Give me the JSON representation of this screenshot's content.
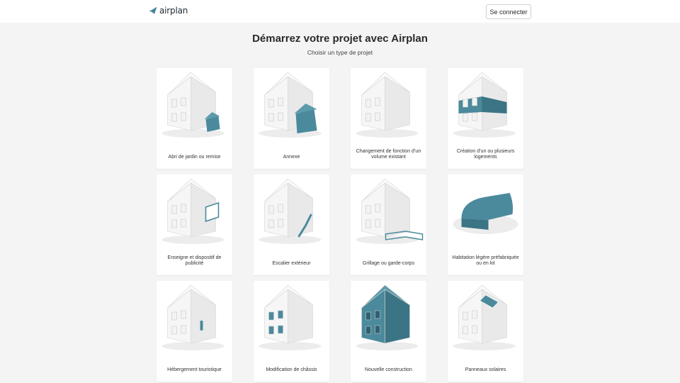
{
  "header": {
    "logo_text": "airplan",
    "logo_icon": "paper-plane-icon",
    "login_label": "Se connecter"
  },
  "main": {
    "title": "Démarrez votre projet avec Airplan",
    "subtitle": "Choisir un type de projet"
  },
  "colors": {
    "accent": "#4a8a9c",
    "house": "#f6f6f6",
    "page_bg": "#f4f4f4"
  },
  "projects": [
    {
      "label": "Abri de jardin ou remise",
      "art": "house-with-shed"
    },
    {
      "label": "Annexe",
      "art": "house-with-annex"
    },
    {
      "label": "Changement de fonction d’un volume existant",
      "art": "house-plain"
    },
    {
      "label": "Création d’un ou plusieurs logements",
      "art": "house-highlighted-floor"
    },
    {
      "label": "Enseigne et dispositif de publicité",
      "art": "house-with-sign"
    },
    {
      "label": "Escalier extérieur",
      "art": "house-with-stairs"
    },
    {
      "label": "Grillage ou garde-corps",
      "art": "house-with-fence"
    },
    {
      "label": "Habitation légère préfabriquée ou en kit",
      "art": "tiny-house"
    },
    {
      "label": "Hébergement touristique",
      "art": "house-with-plaque"
    },
    {
      "label": "Modification de châssis",
      "art": "house-highlighted-windows"
    },
    {
      "label": "Nouvelle construction",
      "art": "house-all-highlighted"
    },
    {
      "label": "Panneaux solaires",
      "art": "house-with-solar-panels"
    }
  ]
}
